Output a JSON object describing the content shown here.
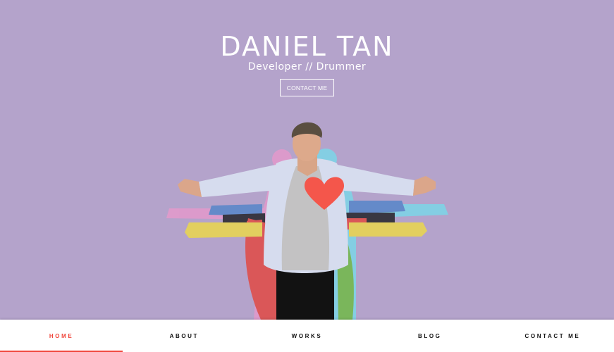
{
  "hero": {
    "name": "DANIEL TAN",
    "tagline": "Developer // Drummer",
    "cta_label": "CONTACT ME"
  },
  "nav": {
    "items": [
      {
        "label": "HOME",
        "active": true
      },
      {
        "label": "ABOUT",
        "active": false
      },
      {
        "label": "WORKS",
        "active": false
      },
      {
        "label": "BLOG",
        "active": false
      },
      {
        "label": "CONTACT ME",
        "active": false
      }
    ]
  },
  "colors": {
    "background": "#b4a3cb",
    "accent": "#f0463b",
    "heart": "#f4564b",
    "text_on_hero": "#ffffff"
  }
}
